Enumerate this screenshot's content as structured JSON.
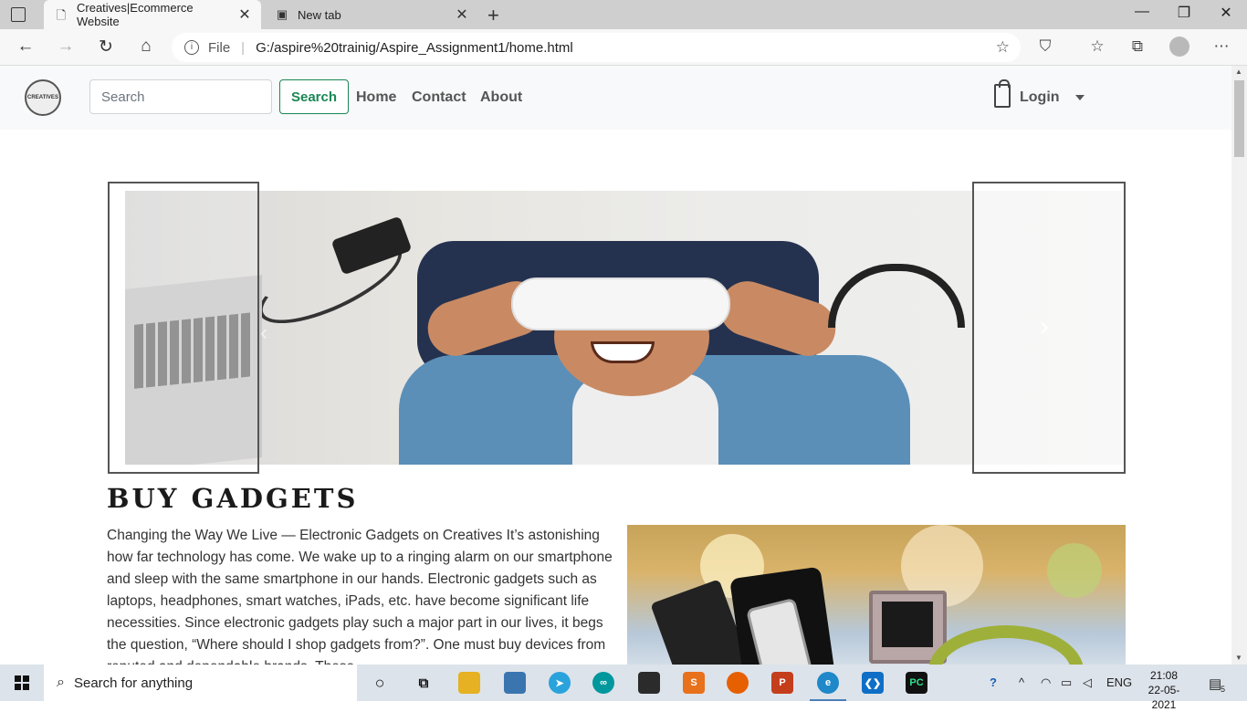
{
  "browser": {
    "tabs": [
      {
        "title": "Creatives|Ecommerce Website",
        "active": true
      },
      {
        "title": "New tab",
        "active": false
      }
    ],
    "address": {
      "scheme_label": "File",
      "url": "G:/aspire%20trainig/Aspire_Assignment1/home.html"
    }
  },
  "site": {
    "logo_text": "CREATIVES",
    "search": {
      "placeholder": "Search",
      "button_label": "Search"
    },
    "nav_links": [
      "Home",
      "Contact",
      "About"
    ],
    "login_label": "Login",
    "section": {
      "heading": "BUY GADGETS",
      "paragraph": "Changing the Way We Live — Electronic Gadgets on Creatives It’s astonishing how far technology has come. We wake up to a ringing alarm on our smartphone and sleep with the same smartphone in our hands. Electronic gadgets such as laptops, headphones, smart watches, iPads, etc. have become significant life necessities. Since electronic gadgets play such a major part in our lives, it begs the question, “Where should I shop gadgets from?”. One must buy devices from reputed and dependable brands. These"
    }
  },
  "taskbar": {
    "search_placeholder": "Search for anything",
    "language": "ENG",
    "time": "21:08",
    "date": "22-05-2021",
    "notification_count": "5"
  }
}
